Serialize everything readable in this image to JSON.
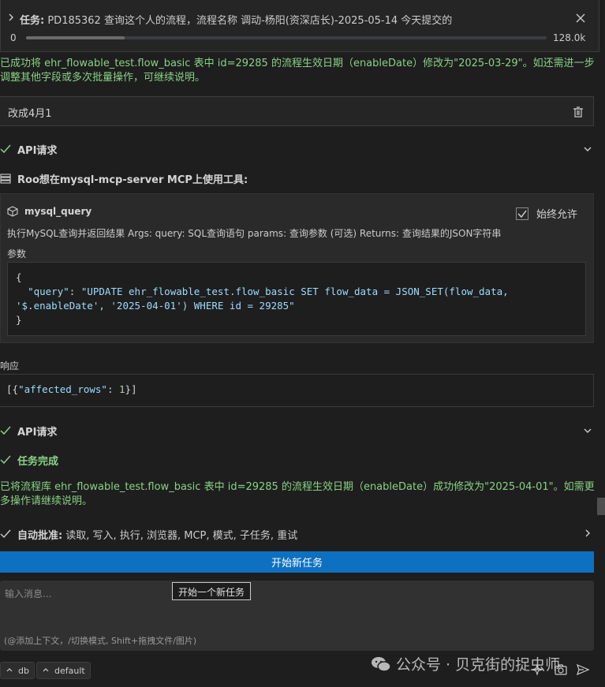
{
  "task": {
    "prefix": "任务:",
    "title": "PD185362 查询这个人的流程，流程名称 调动-杨阳(资深店长)-2025-05-14 今天提交的",
    "context_start": "0",
    "context_end": "128.0k",
    "context_fill_fraction": 0.19
  },
  "messages": {
    "assistant_1": "已成功将 ehr_flowable_test.flow_basic 表中 id=29285 的流程生效日期（enableDate）修改为\"2025-03-29\"。如还需进一步调整其他字段或多次批量操作，可继续说明。",
    "user": "改成4月1",
    "api_request_1": "API请求",
    "mcp_prompt": "Roo想在mysql-mcp-server MCP上使用工具:",
    "tool": {
      "name": "mysql_query",
      "always_allow": "始终允许",
      "always_allow_checked": true,
      "description": "执行MySQL查询并返回结果 Args: query: SQL查询语句 params: 查询参数 (可选) Returns: 查询结果的JSON字符串",
      "params_label": "参数",
      "code_open": "{",
      "code_key": "\"query\"",
      "code_sep": ": ",
      "code_value_1": "\"UPDATE ehr_flowable_test.flow_basic SET flow_data = JSON_SET(flow_data,",
      "code_value_2": "'$.enableDate', '2025-04-01') WHERE id = 29285\"",
      "code_close": "}"
    },
    "response_label": "响应",
    "response": {
      "open": "[{",
      "key": "\"affected_rows\"",
      "sep": ": ",
      "value": "1",
      "close": "}]"
    },
    "api_request_2": "API请求",
    "task_complete": "任务完成",
    "assistant_2": "已将流程库 ehr_flowable_test.flow_basic 表中 id=29285 的流程生效日期（enableDate）成功修改为\"2025-04-01\"。如需更多操作请继续说明。"
  },
  "auto_approve": {
    "label": "自动批准:",
    "items": "读取, 写入, 执行, 浏览器, MCP, 模式, 子任务, 重试",
    "checked": true
  },
  "new_task_button": "开始新任务",
  "input": {
    "placeholder": "输入消息...",
    "hint": "(@添加上下文，/切换模式, Shift+拖拽文件/图片)"
  },
  "tooltip": "开始一个新任务",
  "bottom": {
    "db_label": "db",
    "mode_label": "default"
  },
  "watermark": "公众号 · 贝克街的捉虫师",
  "colors": {
    "background": "#1e1e1e",
    "success_green": "#89d185",
    "button_blue": "#0e70c0"
  }
}
